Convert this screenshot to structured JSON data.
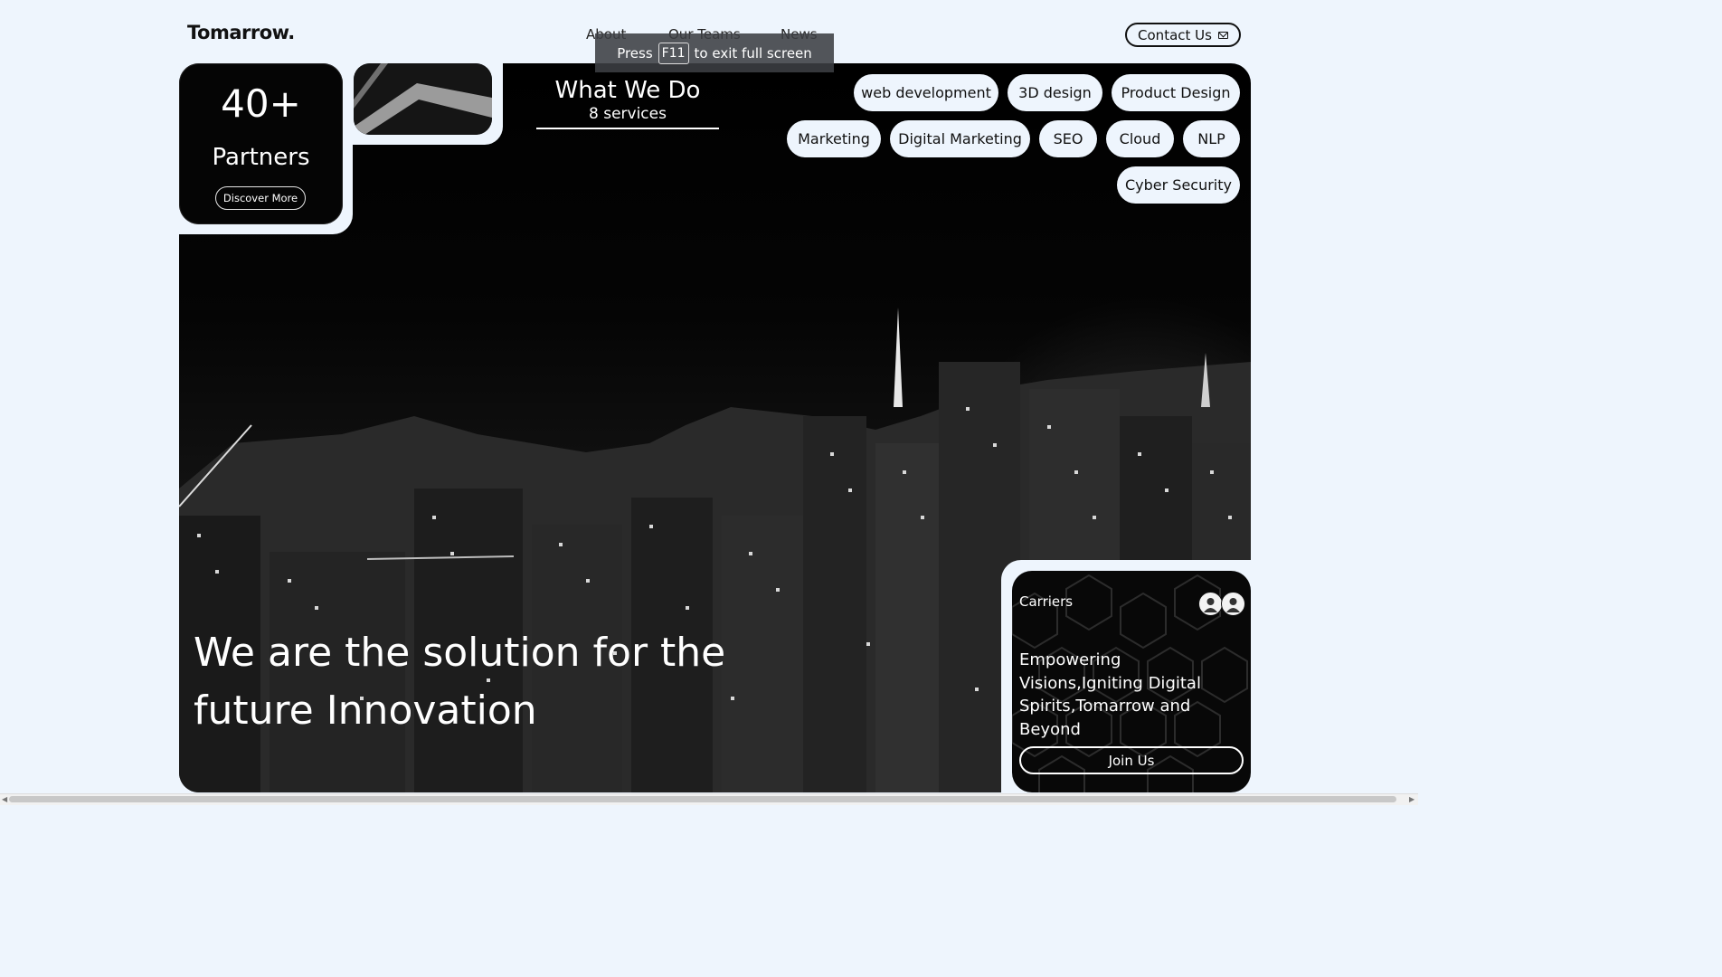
{
  "brand": {
    "logo": "Tomarrow."
  },
  "nav": {
    "about": "About",
    "teams": "Our Teams",
    "news": "News",
    "contact": "Contact Us"
  },
  "fullscreen_toast": {
    "press": "Press",
    "key": "F11",
    "rest": "to exit full screen"
  },
  "partners": {
    "count": "40+",
    "label": "Partners",
    "button": "Discover More"
  },
  "services": {
    "title": "What We Do",
    "subtitle": "8 services",
    "tags": [
      "web development",
      "3D design",
      "Product Design",
      "Marketing",
      "Digital Marketing",
      "SEO",
      "Cloud",
      "NLP",
      "Cyber Security"
    ]
  },
  "hero": {
    "headline_1": "We are the solution for the",
    "headline_2": "future Innovation"
  },
  "careers": {
    "title": "Carriers",
    "description": "Empowering Visions,Igniting Digital Spirits,Tomarrow and Beyond",
    "button": "Join Us"
  },
  "colors": {
    "page_bg": "#eef5fd",
    "hero_bg": "#000000",
    "pill_bg": "#eef5fd",
    "text_dark": "#111111",
    "text_light": "#ffffff"
  }
}
